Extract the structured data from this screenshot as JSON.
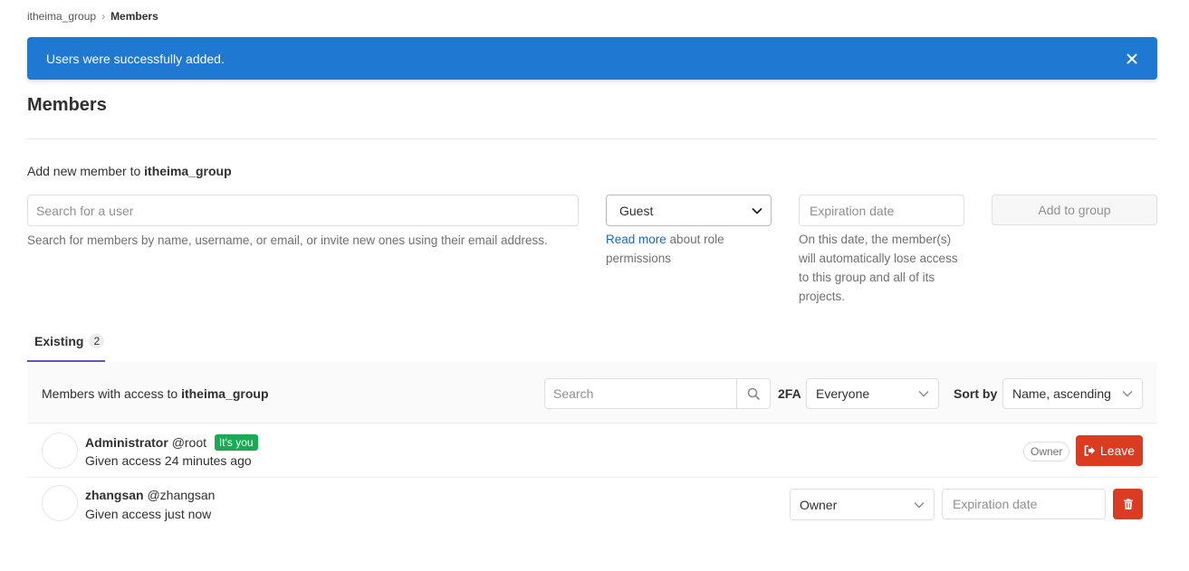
{
  "breadcrumb": {
    "group": "itheima_group",
    "current": "Members"
  },
  "flash": {
    "message": "Users were successfully added."
  },
  "page": {
    "title": "Members"
  },
  "add_member": {
    "label_prefix": "Add new member to ",
    "group": "itheima_group",
    "search_placeholder": "Search for a user",
    "search_help": "Search for members by name, username, or email, or invite new ones using their email address.",
    "role_value": "Guest",
    "role_help_link": "Read more",
    "role_help_rest": " about role permissions",
    "expiration_placeholder": "Expiration date",
    "expiration_help": "On this date, the member(s) will automatically lose access to this group and all of its projects.",
    "add_button": "Add to group"
  },
  "tabs": [
    {
      "label": "Existing",
      "count": "2"
    }
  ],
  "members_panel": {
    "title_prefix": "Members with access to ",
    "group": "itheima_group",
    "search_placeholder": "Search",
    "twofa_label": "2FA",
    "twofa_value": "Everyone",
    "sort_label": "Sort by",
    "sort_value": "Name, ascending"
  },
  "members": [
    {
      "name": "Administrator",
      "handle": "@root",
      "badge": "It's you",
      "given": "Given access 24 minutes ago",
      "role_pill": "Owner",
      "action": "Leave"
    },
    {
      "name": "zhangsan",
      "handle": "@zhangsan",
      "given": "Given access just now",
      "role": "Owner",
      "expiration_placeholder": "Expiration date"
    }
  ],
  "colors": {
    "flash_bg": "#1f78d1",
    "danger": "#db3b21",
    "success": "#1aaa55",
    "tab_active": "#6b4fbb",
    "link": "#1b69b6"
  }
}
